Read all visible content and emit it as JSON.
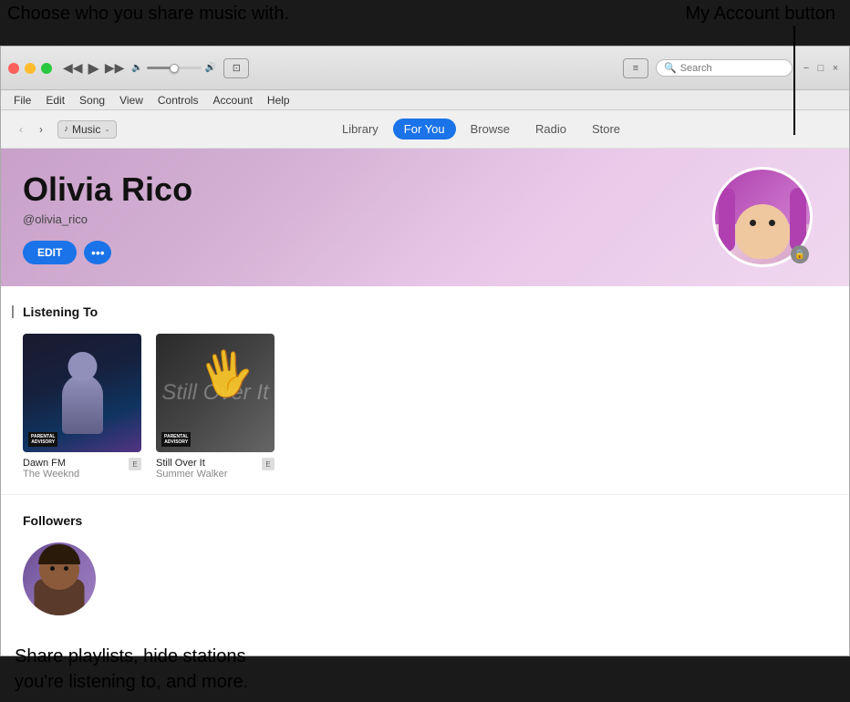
{
  "annotations": {
    "top_left": "Choose who you share music with.",
    "top_right": "My Account button",
    "bottom": "Share playlists, hide stations\nyou're listening to, and more."
  },
  "titlebar": {
    "search_placeholder": "Search",
    "transport": {
      "rewind": "⏮",
      "play": "▶",
      "fast_forward": "⏭"
    }
  },
  "menubar": {
    "items": [
      "File",
      "Edit",
      "Song",
      "View",
      "Controls",
      "Account",
      "Help"
    ]
  },
  "navbar": {
    "source_label": "Music",
    "tabs": [
      "Library",
      "For You",
      "Browse",
      "Radio",
      "Store"
    ],
    "active_tab": "For You"
  },
  "profile": {
    "name": "Olivia Rico",
    "handle": "@olivia_rico",
    "edit_label": "EDIT",
    "more_label": "•••"
  },
  "listening_section": {
    "title": "Listening To",
    "albums": [
      {
        "name": "Dawn FM",
        "artist": "The Weeknd",
        "cover_type": "dawn"
      },
      {
        "name": "Still Over It",
        "artist": "Summer Walker",
        "cover_type": "still"
      }
    ]
  },
  "followers_section": {
    "title": "Followers"
  },
  "icons": {
    "apple": "",
    "search": "🔍",
    "lock": "🔒",
    "list": "≡",
    "chevron_down": "⌄",
    "back": "‹",
    "forward": "›",
    "note": "♪"
  }
}
